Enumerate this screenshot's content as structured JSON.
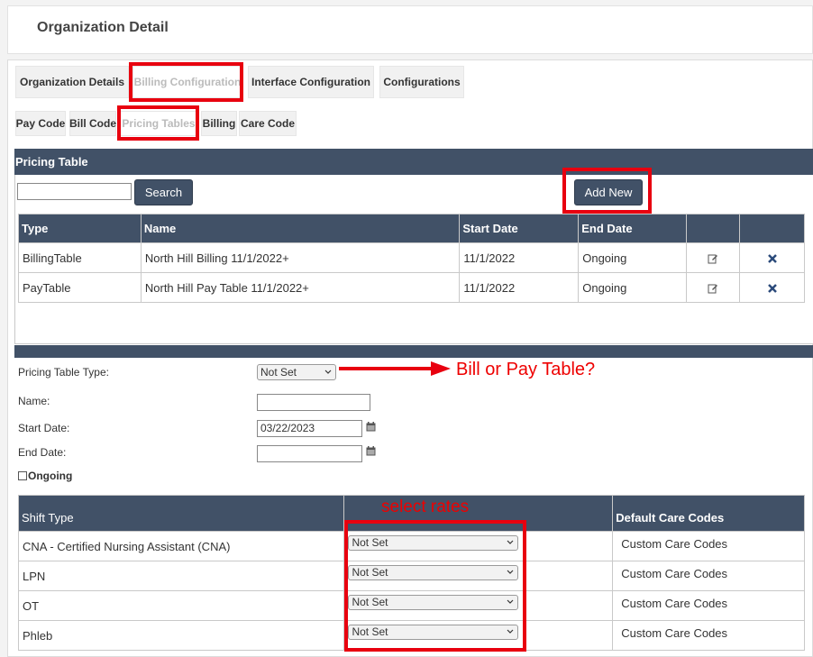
{
  "header": {
    "title": "Organization Detail"
  },
  "tabs": [
    {
      "label": "Organization Details"
    },
    {
      "label": "Billing Configuration"
    },
    {
      "label": "Interface Configuration"
    },
    {
      "label": "Configurations"
    }
  ],
  "subtabs": [
    {
      "label": "Pay Code"
    },
    {
      "label": "Bill Code"
    },
    {
      "label": "Pricing Tables"
    },
    {
      "label": "Billing"
    },
    {
      "label": "Care Code"
    }
  ],
  "pricing_table": {
    "heading": "Pricing Table",
    "search_button": "Search",
    "search_value": "",
    "add_new_button": "Add New",
    "columns": [
      "Type",
      "Name",
      "Start Date",
      "End Date"
    ],
    "rows": [
      {
        "type": "BillingTable",
        "name": "North Hill Billing 11/1/2022+",
        "start": "11/1/2022",
        "end": "Ongoing"
      },
      {
        "type": "PayTable",
        "name": "North Hill Pay Table 11/1/2022+",
        "start": "11/1/2022",
        "end": "Ongoing"
      }
    ]
  },
  "form": {
    "type_label": "Pricing Table Type:",
    "type_value": "Not Set",
    "name_label": "Name:",
    "name_value": "",
    "start_label": "Start Date:",
    "start_value": "03/22/2023",
    "end_label": "End Date:",
    "end_value": "",
    "ongoing_label": "Ongoing"
  },
  "annotations": {
    "bill_or_pay": "Bill or Pay Table?",
    "select_rates": "select rates",
    "color": "#e8000f"
  },
  "shift_table": {
    "columns": [
      "Shift Type",
      "",
      "Default Care Codes"
    ],
    "rows": [
      {
        "shift": "CNA - Certified Nursing Assistant (CNA)",
        "rate": "Not Set",
        "care": "Custom Care Codes"
      },
      {
        "shift": "LPN",
        "rate": "Not Set",
        "care": "Custom Care Codes"
      },
      {
        "shift": "OT",
        "rate": "Not Set",
        "care": "Custom Care Codes"
      },
      {
        "shift": "Phleb",
        "rate": "Not Set",
        "care": "Custom Care Codes"
      }
    ]
  },
  "colors": {
    "header_bg": "#415167",
    "accent_red": "#e8000f"
  }
}
